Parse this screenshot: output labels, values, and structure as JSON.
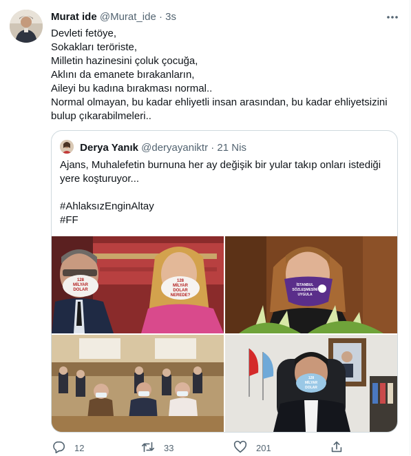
{
  "tweet": {
    "author_name": "Murat ide",
    "handle": "@Murat_ide",
    "separator": "·",
    "time": "3s",
    "lines": [
      "Devleti fetöye,",
      "Sokakları teröriste,",
      "Milletin hazinesini çoluk çocuğa,",
      "Aklını da emanete bırakanların,",
      "Aileyi bu kadına bırakması normal..",
      "Normal olmayan, bu kadar ehliyetli insan arasından, bu kadar ehliyetsizini",
      "bulup çıkarabilmeleri.."
    ]
  },
  "quoted": {
    "author_name": "Derya Yanık",
    "handle": "@deryayaniktr",
    "separator": "·",
    "time": "21 Nis",
    "lines": [
      "Ajans, Muhalefetin burnuna her ay değişik bir yular takıp onları istediği",
      "yere koşturuyor...",
      "",
      "#AhlaksızEnginAltay",
      "#FF"
    ],
    "mask_text": {
      "line1": "128",
      "line2": "MİLYAR",
      "line3": "DOLAR",
      "line4": "NEREDE?"
    },
    "purple_mask_text": {
      "line1": "İSTANBUL",
      "line2": "SÖZLEŞMESİNİ",
      "line3": "UYGULA"
    }
  },
  "actions": {
    "reply_count": "12",
    "retweet_count": "33",
    "like_count": "201"
  },
  "icons": {
    "more": "more-dots-icon",
    "reply": "reply-icon",
    "retweet": "retweet-icon",
    "like": "heart-icon",
    "share": "share-icon"
  },
  "colors": {
    "text": "#0f1419",
    "muted": "#536471",
    "border": "#cfd9de",
    "purple_mask": "#5a2e8a"
  }
}
